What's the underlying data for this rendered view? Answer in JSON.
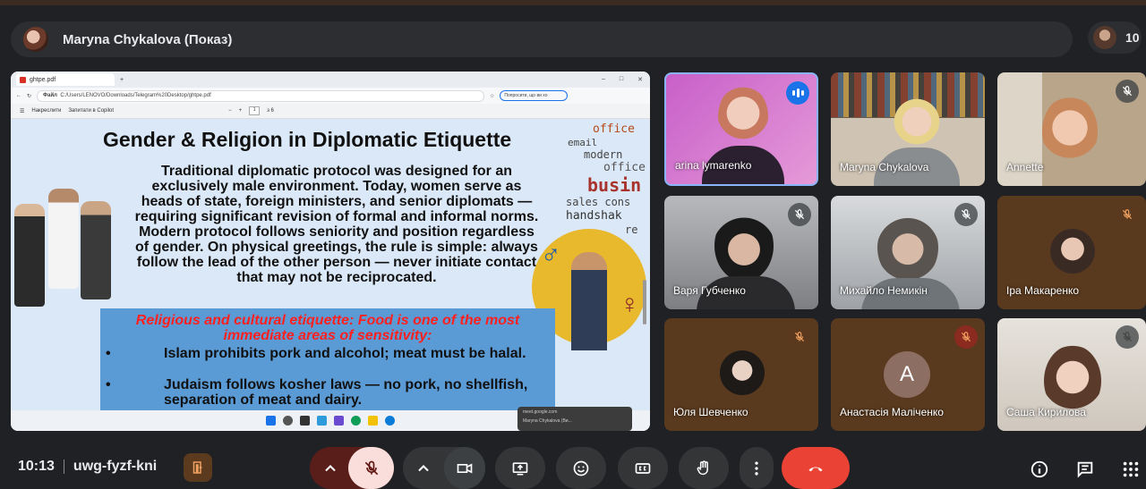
{
  "presenter_bar": {
    "name": "Maryna Chykalova (Показ)"
  },
  "people": {
    "count": "10"
  },
  "browser": {
    "tab_title": "ghtpe.pdf",
    "address_prefix": "Файл",
    "address": "C:/Users/LENOVO/Downloads/Telegram%20Desktop/ghtpe.pdf",
    "search_hint": "Попросити, що ви хо",
    "window_controls": [
      "–",
      "□",
      "✕"
    ],
    "pdf_toolbar": {
      "draw_label": "Накреслити",
      "copilot_label": "Запитати в Copilot",
      "page": "1",
      "page_total": "з 6"
    }
  },
  "slide": {
    "title": "Gender & Religion in Diplomatic Etiquette",
    "paragraph": "Traditional diplomatic protocol was designed for an exclusively male environment. Today, women serve as heads of state, foreign ministers, and senior diplomats — requiring significant revision of formal and informal norms. Modern protocol follows seniority and position regardless of gender. On physical greetings, the rule is simple: always follow the lead of the other person — never initiate contact that may not be reciprocated.",
    "religious_title": "Religious and cultural etiquette: Food is one of the most immediate areas of sensitivity:",
    "bullets": [
      "Islam prohibits pork and alcohol; meat must be halal.",
      "Judaism follows kosher laws — no pork, no shellfish, separation of meat and dairy."
    ],
    "wordcloud": [
      "office",
      "email",
      "modern",
      "office",
      "busin",
      "sales cons",
      "handshak",
      "re"
    ],
    "male_symbol": "♂",
    "female_symbol": "♀"
  },
  "notification": {
    "text": "meet.google.com",
    "sub": "Maryna Chykalova (Ви..."
  },
  "participants": [
    {
      "name": "arina lymarenko",
      "state": "speaking"
    },
    {
      "name": "Maryna Chykalova",
      "state": "none"
    },
    {
      "name": "Annette",
      "state": "muted"
    },
    {
      "name": "Варя Губченко",
      "state": "muted"
    },
    {
      "name": "Михайло Немикін",
      "state": "muted"
    },
    {
      "name": "Іра Макаренко",
      "state": "muted"
    },
    {
      "name": "",
      "state": "muted"
    },
    {
      "name": "Юля Шевченко",
      "state": "none"
    },
    {
      "name": "Анастасія Маліченко",
      "state": "muted",
      "initial": "A"
    },
    {
      "name": "Саша Кирилова",
      "state": "muted"
    }
  ],
  "meeting": {
    "time": "10:13",
    "code": "uwg-fyzf-kni"
  },
  "colors": {
    "end_call": "#ea4335",
    "mic_off_bg": "#f9dedc",
    "speaking": "#1a73e8",
    "tile_brown": "#5a3a1e"
  }
}
